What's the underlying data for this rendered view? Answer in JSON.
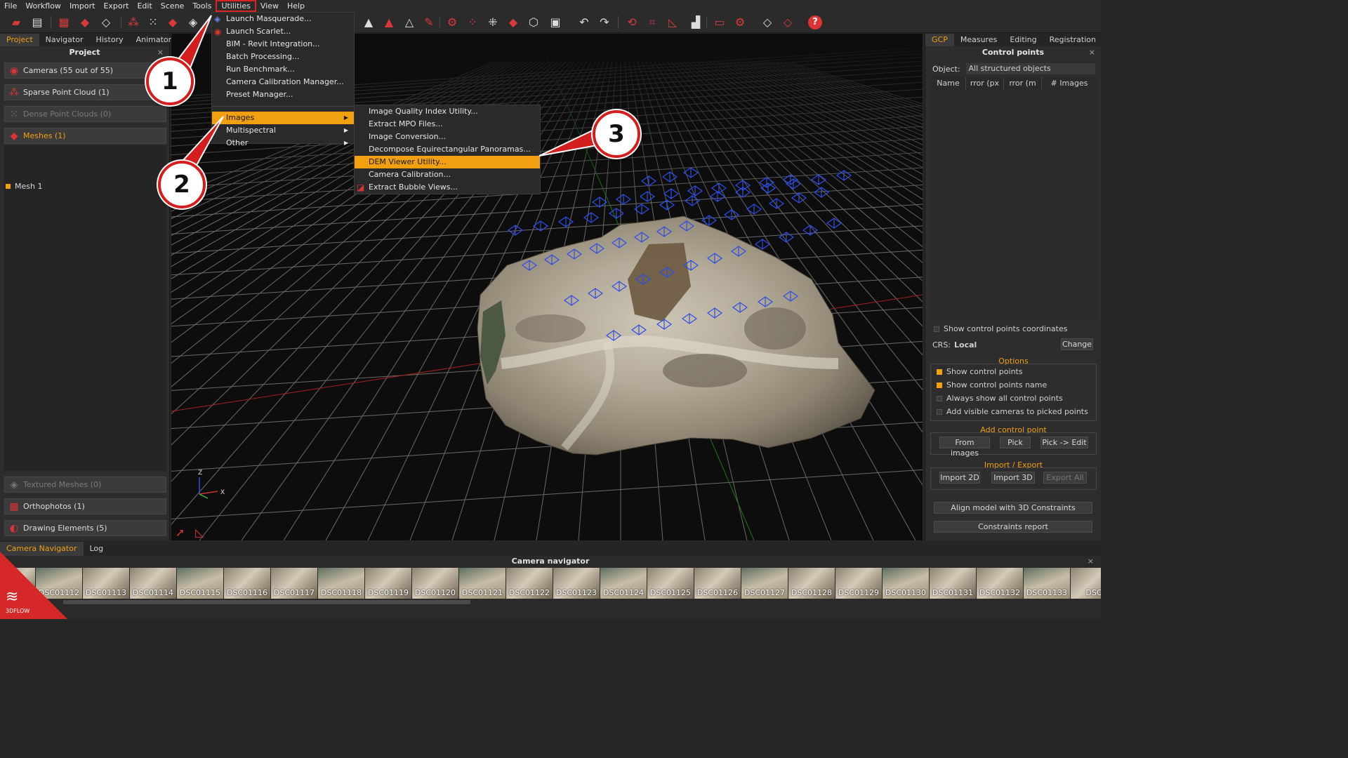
{
  "menubar": [
    "File",
    "Workflow",
    "Import",
    "Export",
    "Edit",
    "Scene",
    "Tools",
    "Utilities",
    "View",
    "Help"
  ],
  "left_panel": {
    "tabs": [
      "Project",
      "Navigator",
      "History",
      "Animator"
    ],
    "title": "Project",
    "close_glyph": "×",
    "sections": {
      "cameras": "Cameras (55 out of 55)",
      "sparse": "Sparse Point Cloud (1)",
      "dense": "Dense Point Clouds (0)",
      "meshes": "Meshes (1)",
      "mesh_item": "Mesh 1",
      "textured": "Textured Meshes (0)",
      "ortho": "Orthophotos (1)",
      "drawing": "Drawing Elements (5)"
    }
  },
  "utilities_menu": {
    "items": [
      "Launch Masquerade...",
      "Launch Scarlet...",
      "BIM - Revit Integration...",
      "Batch Processing...",
      "Run Benchmark...",
      "Camera Calibration Manager...",
      "Preset Manager..."
    ],
    "submenus": [
      "Images",
      "Multispectral",
      "Other"
    ]
  },
  "images_submenu": [
    "Image Quality Index Utility...",
    "Extract MPO Files...",
    "Image Conversion...",
    "Decompose Equirectangular Panoramas...",
    "DEM Viewer Utility...",
    "Camera Calibration...",
    "Extract Bubble Views..."
  ],
  "badges": [
    "1",
    "2",
    "3"
  ],
  "viewport": {
    "axis_z": "Z",
    "axis_x": "X"
  },
  "right_panel": {
    "tabs": [
      "GCP",
      "Measures",
      "Editing",
      "Registration"
    ],
    "title": "Control points",
    "close_glyph": "×",
    "object_label": "Object:",
    "object_value": "All structured objects",
    "columns": [
      "Name",
      "rror (px",
      "rror (m",
      "# Images"
    ],
    "show_coords": "Show control points coordinates",
    "crs_label": "CRS:",
    "crs_value": "Local",
    "change": "Change",
    "options_title": "Options",
    "options": [
      "Show control points",
      "Show control points name",
      "Always show all control points",
      "Add visible cameras to picked points"
    ],
    "add_title": "Add control point",
    "add_buttons": [
      "From images",
      "Pick",
      "Pick -> Edit"
    ],
    "ie_title": "Import / Export",
    "ie_buttons": [
      "Import 2D",
      "Import 3D",
      "Export All"
    ],
    "align": "Align model with 3D Constraints",
    "report": "Constraints report"
  },
  "bottom_panel": {
    "tabs": [
      "Camera Navigator",
      "Log"
    ],
    "title": "Camera navigator",
    "close_glyph": "×",
    "thumbs": [
      "1",
      "DSC01112",
      "DSC01113",
      "DSC01114",
      "DSC01115",
      "DSC01116",
      "DSC01117",
      "DSC01118",
      "DSC01119",
      "DSC01120",
      "DSC01121",
      "DSC01122",
      "DSC01123",
      "DSC01124",
      "DSC01125",
      "DSC01126",
      "DSC01127",
      "DSC01128",
      "DSC01129",
      "DSC01130",
      "DSC01131",
      "DSC01132",
      "DSC01133",
      "DSC"
    ]
  },
  "logo_text": "3DFLOW",
  "colors": {
    "accent": "#f0a010",
    "annotation_red": "#d41e1e"
  }
}
